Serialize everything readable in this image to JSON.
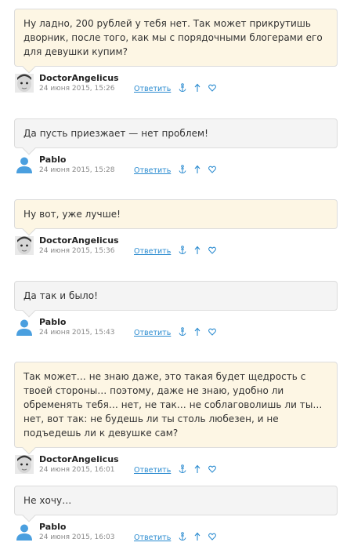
{
  "comments": [
    {
      "kind": "author",
      "text": "Ну ладно, 200 рублей у тебя нет. Так может прикрутишь дворник, после того, как мы с порядочными блогерами его для девушки купим?",
      "user": "DoctorAngelicus",
      "date": "24 июня 2015, 15:26",
      "reply": "Ответить"
    },
    {
      "kind": "guest",
      "text": "Да пусть приезжает — нет проблем!",
      "user": "Pablo",
      "date": "24 июня 2015, 15:28",
      "reply": "Ответить"
    },
    {
      "kind": "author",
      "text": "Ну вот, уже лучше!",
      "user": "DoctorAngelicus",
      "date": "24 июня 2015, 15:36",
      "reply": "Ответить"
    },
    {
      "kind": "guest",
      "text": "Да так и было!",
      "user": "Pablo",
      "date": "24 июня 2015, 15:43",
      "reply": "Ответить"
    },
    {
      "kind": "author",
      "text": "Так может… не знаю даже, это такая будет щедрость с твоей стороны… поэтому, даже не знаю, удобно ли обременять тебя… нет, не так… не соблаговолишь ли ты… нет, вот так: не будешь ли ты столь любезен, и не подъедешь ли к девушке сам?",
      "user": "DoctorAngelicus",
      "date": "24 июня 2015, 16:01",
      "reply": "Ответить"
    },
    {
      "kind": "guest",
      "text": "Не хочу…",
      "user": "Pablo",
      "date": "24 июня 2015, 16:03",
      "reply": "Ответить"
    }
  ],
  "icons": {
    "anchor": "anchor-icon",
    "up": "arrow-up-icon",
    "like": "heart-icon",
    "author_avatar": "baby-photo-avatar",
    "guest_avatar": "default-user-avatar"
  },
  "colors": {
    "author_bubble": "#fdf6e4",
    "guest_bubble": "#f4f4f4",
    "link": "#2a8bd0",
    "guest_avatar": "#4a9fdf"
  }
}
